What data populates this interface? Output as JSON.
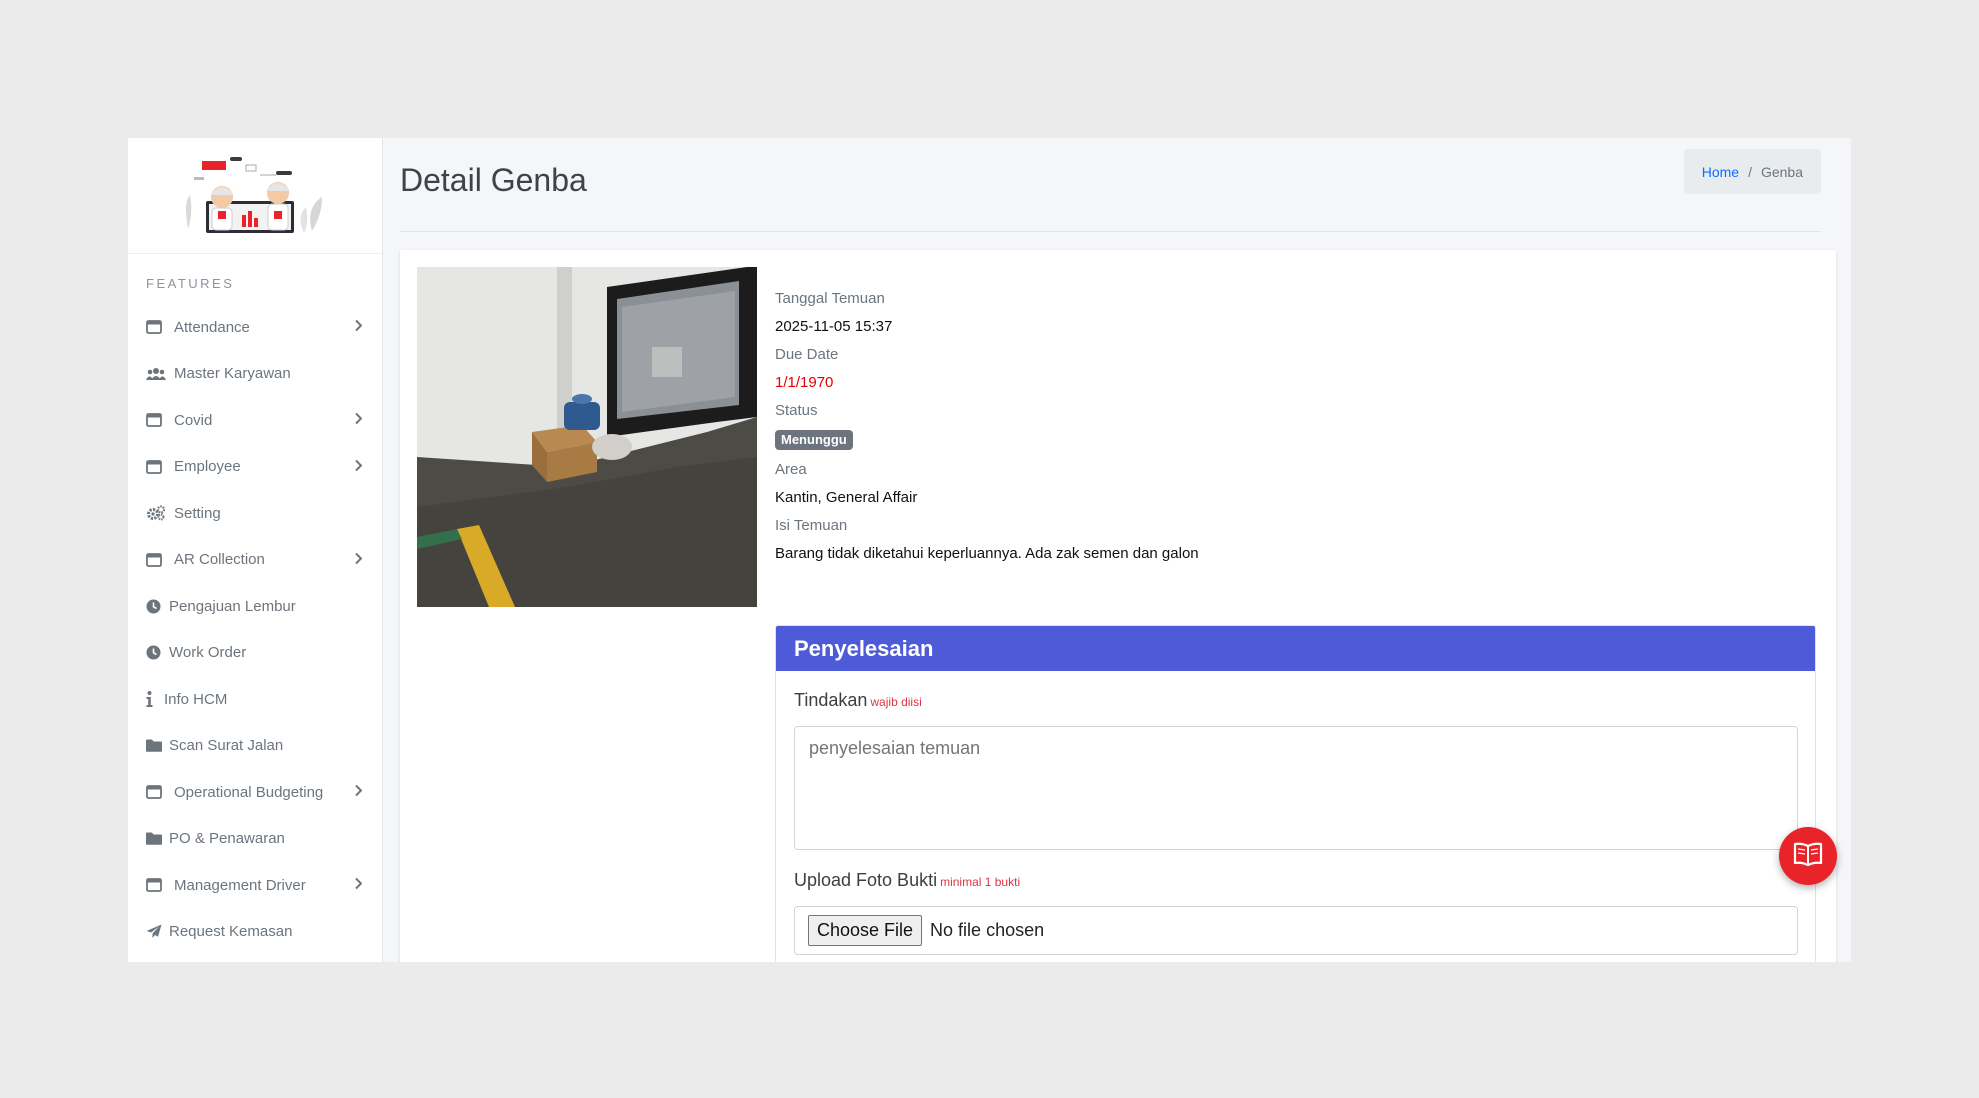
{
  "sidebar": {
    "section_title": "FEATURES",
    "items": [
      {
        "label": "Attendance",
        "icon": "window-icon",
        "has_submenu": true
      },
      {
        "label": "Master Karyawan",
        "icon": "users-icon",
        "has_submenu": false
      },
      {
        "label": "Covid",
        "icon": "window-icon",
        "has_submenu": true
      },
      {
        "label": "Employee",
        "icon": "window-icon",
        "has_submenu": true
      },
      {
        "label": "Setting",
        "icon": "gears-icon",
        "has_submenu": false
      },
      {
        "label": "AR Collection",
        "icon": "window-icon",
        "has_submenu": true
      },
      {
        "label": "Pengajuan Lembur",
        "icon": "clock-icon",
        "has_submenu": false
      },
      {
        "label": "Work Order",
        "icon": "clock-icon",
        "has_submenu": false
      },
      {
        "label": "Info HCM",
        "icon": "info-icon",
        "has_submenu": false
      },
      {
        "label": "Scan Surat Jalan",
        "icon": "folder-icon",
        "has_submenu": false
      },
      {
        "label": "Operational Budgeting",
        "icon": "window-icon",
        "has_submenu": true
      },
      {
        "label": "PO & Penawaran",
        "icon": "folder-icon",
        "has_submenu": false
      },
      {
        "label": "Management Driver",
        "icon": "window-icon",
        "has_submenu": true
      },
      {
        "label": "Request Kemasan",
        "icon": "paper-plane-icon",
        "has_submenu": false
      }
    ]
  },
  "header": {
    "title": "Detail Genba",
    "breadcrumb": {
      "home": "Home",
      "separator": "/",
      "current": "Genba"
    }
  },
  "detail": {
    "tanggal_label": "Tanggal Temuan",
    "tanggal_value": "2025-11-05 15:37",
    "due_label": "Due Date",
    "due_value": "1/1/1970",
    "status_label": "Status",
    "status_value": "Menunggu",
    "area_label": "Area",
    "area_value": "Kantin, General Affair",
    "isi_label": "Isi Temuan",
    "isi_value": "Barang tidak diketahui keperluannya. Ada zak semen dan galon"
  },
  "solution": {
    "title": "Penyelesaian",
    "tindakan_label": "Tindakan",
    "tindakan_required": "wajib diisi",
    "tindakan_placeholder": "penyelesaian temuan",
    "upload_label": "Upload Foto Bukti",
    "upload_required": "minimal 1 bukti",
    "file_button": "Choose File",
    "file_status": "No file chosen"
  },
  "colors": {
    "accent": "#4d5bd8",
    "danger": "#e00000",
    "fab": "#e8242a",
    "badge": "#6c757d"
  }
}
